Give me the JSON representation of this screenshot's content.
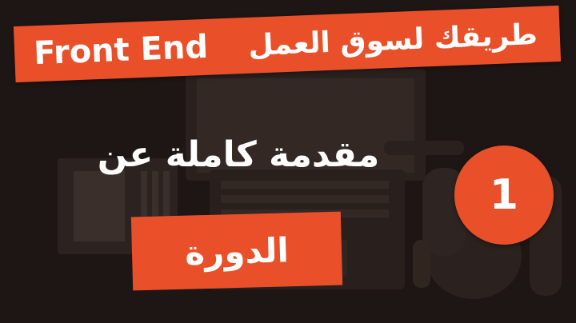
{
  "banner": {
    "english": "Front End",
    "arabic": "طريقك لسوق العمل"
  },
  "headline": "مقدمة كاملة عن",
  "subtitle": "الدورة",
  "episode_number": "1",
  "colors": {
    "accent": "#e9502a",
    "background": "#1e1614",
    "text": "#ffffff"
  }
}
